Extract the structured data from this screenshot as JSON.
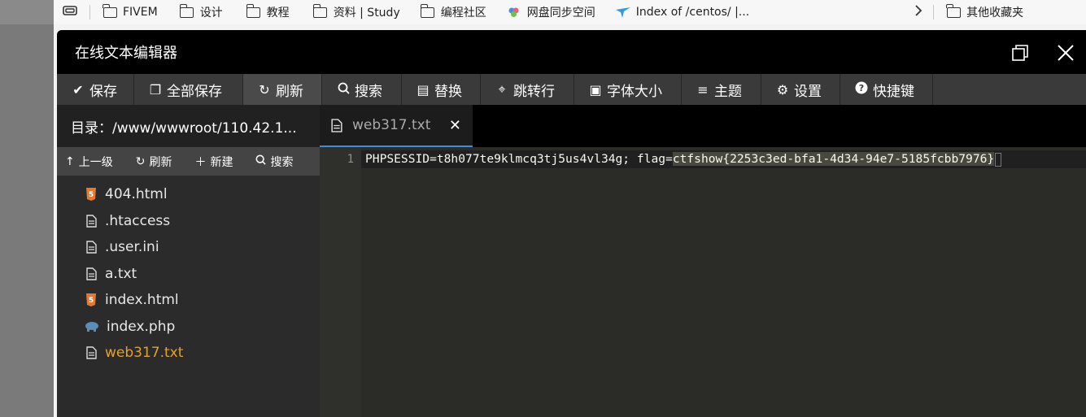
{
  "bookmarks": {
    "items": [
      {
        "label": "FIVEM"
      },
      {
        "label": "设计"
      },
      {
        "label": "教程"
      },
      {
        "label": "资料 | Study"
      },
      {
        "label": "编程社区"
      },
      {
        "label": "网盘同步空间"
      },
      {
        "label": "Index of /centos/ |..."
      }
    ],
    "other": "其他收藏夹"
  },
  "editor": {
    "title": "在线文本编辑器",
    "toolbar": {
      "save": "保存",
      "save_all": "全部保存",
      "refresh": "刷新",
      "search": "搜索",
      "replace": "替换",
      "goto": "跳转行",
      "font_size": "字体大小",
      "theme": "主题",
      "settings": "设置",
      "shortcuts": "快捷键"
    },
    "sidebar": {
      "directory": "目录：/www/wwwroot/110.42.1...",
      "actions": {
        "up": "上一级",
        "refresh": "刷新",
        "new": "新建",
        "search": "搜索"
      },
      "files": [
        {
          "name": "404.html",
          "icon": "html5-icon"
        },
        {
          "name": ".htaccess",
          "icon": "file-icon"
        },
        {
          "name": ".user.ini",
          "icon": "file-icon"
        },
        {
          "name": "a.txt",
          "icon": "file-icon"
        },
        {
          "name": "index.html",
          "icon": "html5-icon"
        },
        {
          "name": "index.php",
          "icon": "php-elephant-icon"
        },
        {
          "name": "web317.txt",
          "icon": "file-icon",
          "active": true
        }
      ]
    },
    "tab": {
      "name": "web317.txt"
    },
    "code": {
      "line_number": "1",
      "prefix": "PHPSESSID=t8h077te9klmcq3tj5us4vl34g; flag=",
      "selected": "ctfshow{2253c3ed-bfa1-4d34-94e7-5185fcbb7976}"
    }
  }
}
